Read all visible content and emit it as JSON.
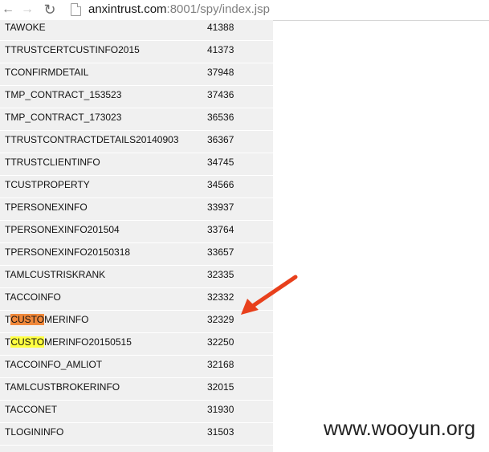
{
  "browser": {
    "url_host": "anxintrust.com",
    "url_rest": ":8001/spy/index.jsp",
    "back_icon": "back-arrow-icon",
    "forward_icon": "forward-arrow-icon",
    "reload_icon": "reload-icon"
  },
  "table": {
    "rows": [
      {
        "name": "TAWOKE",
        "count": "41388"
      },
      {
        "name": "TTRUSTCERTCUSTINFO2015",
        "count": "41373"
      },
      {
        "name": "TCONFIRMDETAIL",
        "count": "37948"
      },
      {
        "name": "TMP_CONTRACT_153523",
        "count": "37436"
      },
      {
        "name": "TMP_CONTRACT_173023",
        "count": "36536"
      },
      {
        "name": "TTRUSTCONTRACTDETAILS20140903",
        "count": "36367"
      },
      {
        "name": "TTRUSTCLIENTINFO",
        "count": "34745"
      },
      {
        "name": "TCUSTPROPERTY",
        "count": "34566"
      },
      {
        "name": "TPERSONEXINFO",
        "count": "33937"
      },
      {
        "name": "TPERSONEXINFO201504",
        "count": "33764"
      },
      {
        "name": "TPERSONEXINFO20150318",
        "count": "33657"
      },
      {
        "name": "TAMLCUSTRISKRANK",
        "count": "32335"
      },
      {
        "name": "TACCOINFO",
        "count": "32332"
      },
      {
        "name_pre": "T",
        "name_hl": "CUSTO",
        "name_post": "MERINFO",
        "count": "32329",
        "highlight": "#f0883a"
      },
      {
        "name_pre": "T",
        "name_hl": "CUSTO",
        "name_post": "MERINFO20150515",
        "count": "32250",
        "highlight": "#ffff40"
      },
      {
        "name": "TACCOINFO_AMLIOT",
        "count": "32168"
      },
      {
        "name": "TAMLCUSTBROKERINFO",
        "count": "32015"
      },
      {
        "name": "TACCONET",
        "count": "31930"
      },
      {
        "name": "TLOGININFO",
        "count": "31503"
      }
    ]
  },
  "annotation": {
    "arrow_color": "#e8401c"
  },
  "watermark": "www.wooyun.org"
}
